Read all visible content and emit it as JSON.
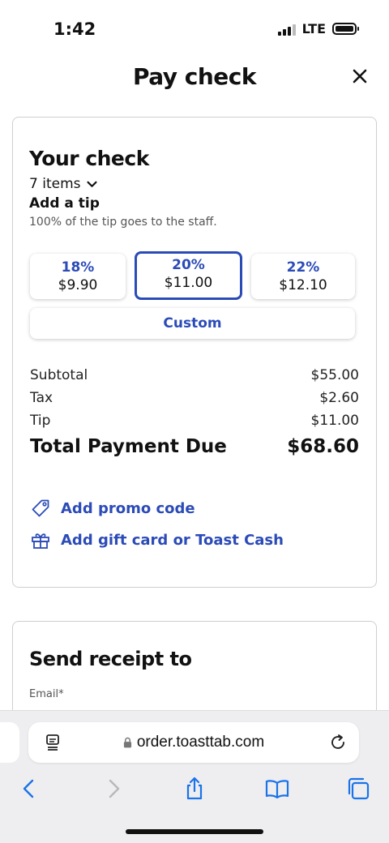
{
  "status_bar": {
    "time": "1:42",
    "network": "LTE"
  },
  "header": {
    "title": "Pay check"
  },
  "check": {
    "title": "Your check",
    "items_toggle": "7 items",
    "tip_heading": "Add a tip",
    "tip_note": "100% of the tip goes to the staff.",
    "tip_options": [
      {
        "percent": "18%",
        "amount": "$9.90"
      },
      {
        "percent": "20%",
        "amount": "$11.00",
        "selected": true
      },
      {
        "percent": "22%",
        "amount": "$12.10"
      }
    ],
    "custom_label": "Custom",
    "summary": {
      "subtotal_label": "Subtotal",
      "subtotal_value": "$55.00",
      "tax_label": "Tax",
      "tax_value": "$2.60",
      "tip_label": "Tip",
      "tip_value": "$11.00",
      "total_label": "Total Payment Due",
      "total_value": "$68.60"
    },
    "promo_label": "Add promo code",
    "gift_label": "Add gift card or Toast Cash"
  },
  "receipt": {
    "title": "Send receipt to",
    "email_label": "Email*"
  },
  "browser": {
    "url": "order.toasttab.com"
  },
  "colors": {
    "accent": "#2b4bb7",
    "ios_blue": "#1a73e8"
  }
}
